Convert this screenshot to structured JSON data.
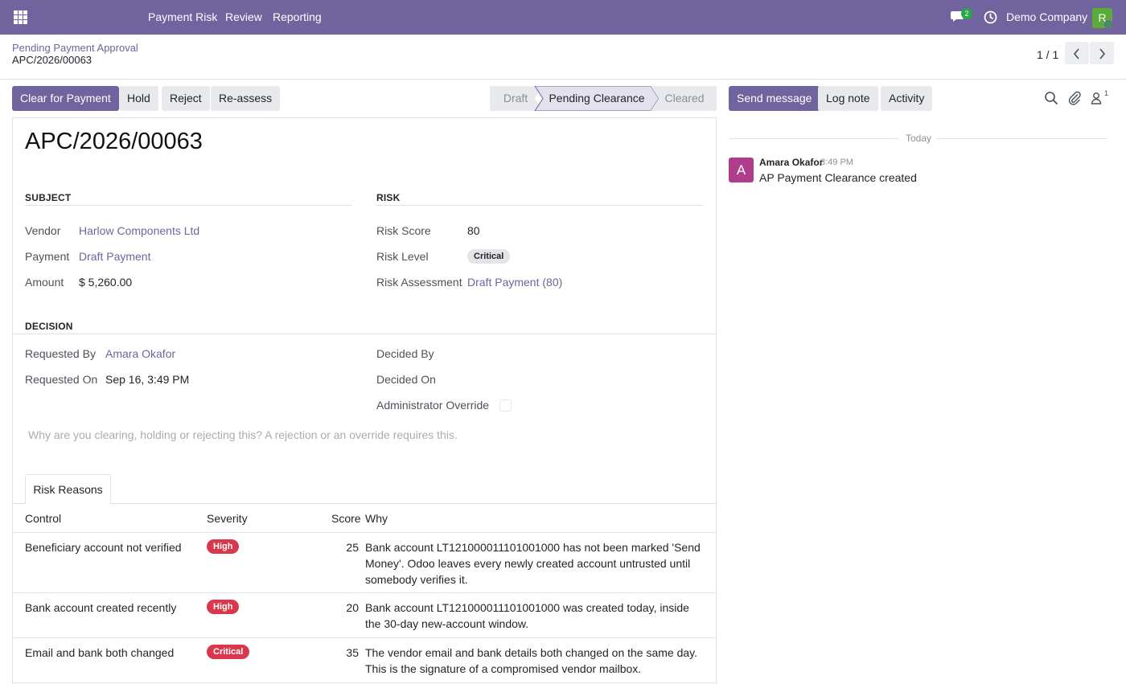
{
  "navbar": {
    "menu": [
      "Payment Risk",
      "Review",
      "Reporting"
    ],
    "messages_count": "2",
    "company": "Demo Company",
    "user_initial": "R"
  },
  "breadcrumb": {
    "parent": "Pending Payment Approval",
    "current": "APC/2026/00063"
  },
  "pager": {
    "value": "1 / 1",
    "prev": "‹",
    "next": "›"
  },
  "actions": {
    "clear": "Clear for Payment",
    "hold": "Hold",
    "reject": "Reject",
    "reassess": "Re-assess"
  },
  "statusbar": {
    "stages": [
      "Draft",
      "Pending Clearance",
      "Cleared"
    ],
    "current_stage": "Pending Clearance"
  },
  "record": {
    "title": "APC/2026/00063"
  },
  "subject": {
    "title": "SUBJECT",
    "vendor_label": "Vendor",
    "vendor": "Harlow Components Ltd",
    "payment_label": "Payment",
    "payment": "Draft Payment",
    "amount_label": "Amount",
    "amount": "$ 5,260.00"
  },
  "risk": {
    "title": "RISK",
    "score_label": "Risk Score",
    "score": "80",
    "level_label": "Risk Level",
    "level": "Critical",
    "assessment_label": "Risk Assessment",
    "assessment": "Draft Payment (80)"
  },
  "decision": {
    "title": "DECISION",
    "requested_by_label": "Requested By",
    "requested_by": "Amara Okafor",
    "requested_on_label": "Requested On",
    "requested_on": "Sep 16, 3:49 PM",
    "decided_by_label": "Decided By",
    "decided_on_label": "Decided On",
    "override_label": "Administrator Override",
    "override_checked": false,
    "reason_placeholder": "Why are you clearing, holding or rejecting this? A rejection or an override requires this."
  },
  "tabs": [
    "Risk Reasons"
  ],
  "risk_reasons": {
    "headers": {
      "control": "Control",
      "severity": "Severity",
      "score": "Score",
      "why": "Why"
    },
    "rows": [
      {
        "control": "Beneficiary account not verified",
        "severity": "High",
        "score": "25",
        "why": "Bank account LT121000011101001000 has not been marked 'Send Money'. Odoo leaves every newly created account untrusted until somebody verifies it."
      },
      {
        "control": "Bank account created recently",
        "severity": "High",
        "score": "20",
        "why": "Bank account LT121000011101001000 was created today, inside the 30-day new-account window."
      },
      {
        "control": "Email and bank both changed",
        "severity": "Critical",
        "score": "35",
        "why": "The vendor email and bank details both changed on the same day. This is the signature of a compromised vendor mailbox."
      }
    ]
  },
  "chatter": {
    "send_message": "Send message",
    "log_note": "Log note",
    "activity": "Activity",
    "followers_count": "1",
    "date_separator": "Today",
    "messages": [
      {
        "author_initial": "A",
        "author": "Amara Okafor",
        "time": "3:49 PM",
        "body": "AP Payment Clearance created"
      }
    ]
  },
  "colors": {
    "brand": "#71639e",
    "high": "#d9384c",
    "critical": "#d9384c",
    "success": "#28a745"
  }
}
